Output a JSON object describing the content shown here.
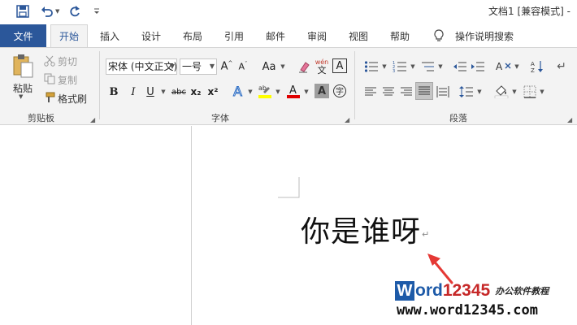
{
  "window": {
    "title": "文档1 [兼容模式] -"
  },
  "tabs": {
    "file": "文件",
    "items": [
      "开始",
      "插入",
      "设计",
      "布局",
      "引用",
      "邮件",
      "审阅",
      "视图",
      "帮助"
    ],
    "tell_me": "操作说明搜索"
  },
  "clipboard": {
    "paste": "粘贴",
    "cut": "剪切",
    "copy": "复制",
    "format_painter": "格式刷",
    "label": "剪贴板"
  },
  "font": {
    "name": "宋体 (中文正文)",
    "size": "一号",
    "aa_label": "Aa",
    "wen_top": "wén",
    "wen_bottom": "文",
    "a_box": "A",
    "bold": "B",
    "italic": "I",
    "underline": "U",
    "strike": "abc",
    "subscript": "x₂",
    "superscript": "x²",
    "label": "字体"
  },
  "paragraph": {
    "label": "段落"
  },
  "document": {
    "text": "你是谁呀",
    "para_mark": "↵"
  },
  "watermark": {
    "w": "W",
    "ord": "ord",
    "num": "12345",
    "sub": "办公软件教程",
    "url": "www.word12345.com"
  },
  "colors": {
    "accent": "#2b579a",
    "highlight": "#ffff00",
    "font_color": "#e00000",
    "arrow": "#e53935"
  }
}
